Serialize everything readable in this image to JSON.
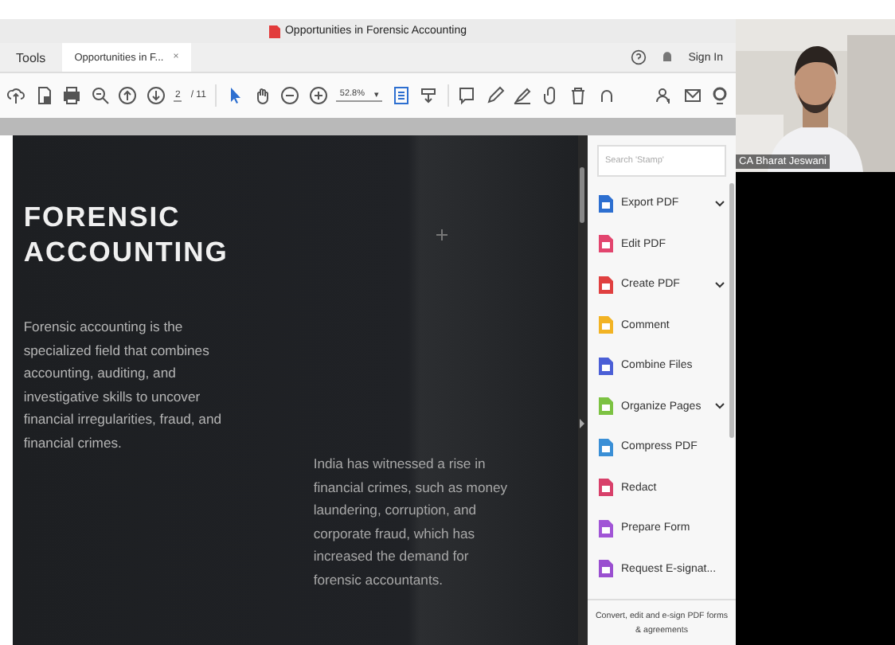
{
  "window": {
    "title": "Opportunities in Forensic Accounting"
  },
  "menu": {
    "label": "Tools"
  },
  "tabs": [
    {
      "label": "Opportunities in F...",
      "close": "×",
      "selected": true
    }
  ],
  "account": {
    "sign_in": "Sign In"
  },
  "toolbar": {
    "page": "2",
    "page_count": "/ 11",
    "zoom": "52.8%",
    "zoom_caret": "▾"
  },
  "document": {
    "heading": "FORENSIC ACCOUNTING",
    "paragraphs": [
      "Forensic accounting is the specialized field that combines accounting, auditing, and investigative skills to uncover financial irregularities, fraud, and financial crimes.",
      "India has witnessed a rise in financial crimes, such as money laundering, corruption, and corporate fraud, which has increased the demand for forensic accountants."
    ]
  },
  "tools_pane": {
    "search": {
      "placeholder": "Search 'Stamp'"
    },
    "tools": [
      {
        "label": "Export PDF",
        "color": "#2d6fd0",
        "has_menu": true
      },
      {
        "label": "Edit PDF",
        "color": "#e2456e",
        "has_menu": false
      },
      {
        "label": "Create PDF",
        "color": "#e04040",
        "has_menu": true
      },
      {
        "label": "Comment",
        "color": "#f2b324",
        "has_menu": false
      },
      {
        "label": "Combine Files",
        "color": "#4b5fd6",
        "has_menu": false
      },
      {
        "label": "Organize Pages",
        "color": "#7cc242",
        "has_menu": true
      },
      {
        "label": "Compress PDF",
        "color": "#3a8fd6",
        "has_menu": false
      },
      {
        "label": "Redact",
        "color": "#d8406a",
        "has_menu": false
      },
      {
        "label": "Prepare Form",
        "color": "#a155d6",
        "has_menu": false
      },
      {
        "label": "Request E-signat...",
        "color": "#9a4fd0",
        "has_menu": false
      }
    ],
    "footer": "Convert, edit and e-sign PDF forms & agreements"
  },
  "video": {
    "kind": "picture",
    "participant": "CA Bharat Jeswani"
  }
}
